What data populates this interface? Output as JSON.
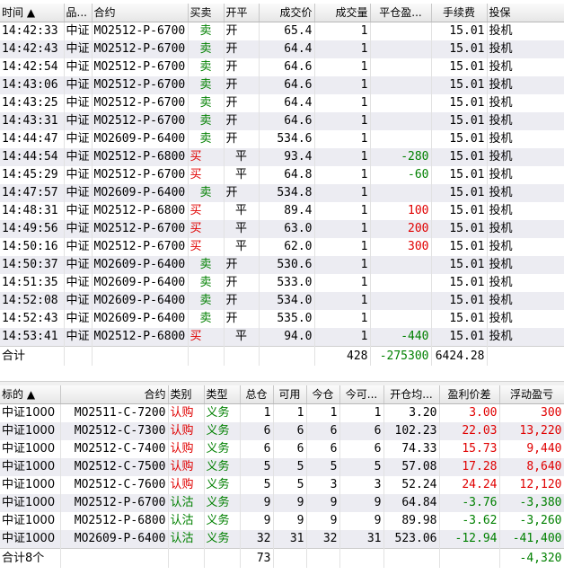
{
  "trades": {
    "headers": [
      "时间 ▲",
      "品...",
      "合约",
      "买卖",
      "开平",
      "成交价",
      "成交量",
      "平仓盈...",
      "手续费",
      "投保"
    ],
    "rows": [
      {
        "time": "14:42:33",
        "variety": "中证",
        "contract": "MO2512-P-6700",
        "side": "卖",
        "oc": "开",
        "price": "65.4",
        "qty": "1",
        "pnl": "",
        "fee": "15.01",
        "hedge": "投机"
      },
      {
        "time": "14:42:43",
        "variety": "中证",
        "contract": "MO2512-P-6700",
        "side": "卖",
        "oc": "开",
        "price": "64.4",
        "qty": "1",
        "pnl": "",
        "fee": "15.01",
        "hedge": "投机"
      },
      {
        "time": "14:42:54",
        "variety": "中证",
        "contract": "MO2512-P-6700",
        "side": "卖",
        "oc": "开",
        "price": "64.6",
        "qty": "1",
        "pnl": "",
        "fee": "15.01",
        "hedge": "投机"
      },
      {
        "time": "14:43:06",
        "variety": "中证",
        "contract": "MO2512-P-6700",
        "side": "卖",
        "oc": "开",
        "price": "64.6",
        "qty": "1",
        "pnl": "",
        "fee": "15.01",
        "hedge": "投机"
      },
      {
        "time": "14:43:25",
        "variety": "中证",
        "contract": "MO2512-P-6700",
        "side": "卖",
        "oc": "开",
        "price": "64.4",
        "qty": "1",
        "pnl": "",
        "fee": "15.01",
        "hedge": "投机"
      },
      {
        "time": "14:43:31",
        "variety": "中证",
        "contract": "MO2512-P-6700",
        "side": "卖",
        "oc": "开",
        "price": "64.6",
        "qty": "1",
        "pnl": "",
        "fee": "15.01",
        "hedge": "投机"
      },
      {
        "time": "14:44:47",
        "variety": "中证",
        "contract": "MO2609-P-6400",
        "side": "卖",
        "oc": "开",
        "price": "534.6",
        "qty": "1",
        "pnl": "",
        "fee": "15.01",
        "hedge": "投机"
      },
      {
        "time": "14:44:54",
        "variety": "中证",
        "contract": "MO2512-P-6800",
        "side": "买",
        "oc": "平",
        "price": "93.4",
        "qty": "1",
        "pnl": "-280",
        "fee": "15.01",
        "hedge": "投机"
      },
      {
        "time": "14:45:29",
        "variety": "中证",
        "contract": "MO2512-P-6700",
        "side": "买",
        "oc": "平",
        "price": "64.8",
        "qty": "1",
        "pnl": "-60",
        "fee": "15.01",
        "hedge": "投机"
      },
      {
        "time": "14:47:57",
        "variety": "中证",
        "contract": "MO2609-P-6400",
        "side": "卖",
        "oc": "开",
        "price": "534.8",
        "qty": "1",
        "pnl": "",
        "fee": "15.01",
        "hedge": "投机"
      },
      {
        "time": "14:48:31",
        "variety": "中证",
        "contract": "MO2512-P-6800",
        "side": "买",
        "oc": "平",
        "price": "89.4",
        "qty": "1",
        "pnl": "100",
        "fee": "15.01",
        "hedge": "投机"
      },
      {
        "time": "14:49:56",
        "variety": "中证",
        "contract": "MO2512-P-6700",
        "side": "买",
        "oc": "平",
        "price": "63.0",
        "qty": "1",
        "pnl": "200",
        "fee": "15.01",
        "hedge": "投机"
      },
      {
        "time": "14:50:16",
        "variety": "中证",
        "contract": "MO2512-P-6700",
        "side": "买",
        "oc": "平",
        "price": "62.0",
        "qty": "1",
        "pnl": "300",
        "fee": "15.01",
        "hedge": "投机"
      },
      {
        "time": "14:50:37",
        "variety": "中证",
        "contract": "MO2609-P-6400",
        "side": "卖",
        "oc": "开",
        "price": "530.6",
        "qty": "1",
        "pnl": "",
        "fee": "15.01",
        "hedge": "投机"
      },
      {
        "time": "14:51:35",
        "variety": "中证",
        "contract": "MO2609-P-6400",
        "side": "卖",
        "oc": "开",
        "price": "533.0",
        "qty": "1",
        "pnl": "",
        "fee": "15.01",
        "hedge": "投机"
      },
      {
        "time": "14:52:08",
        "variety": "中证",
        "contract": "MO2609-P-6400",
        "side": "卖",
        "oc": "开",
        "price": "534.0",
        "qty": "1",
        "pnl": "",
        "fee": "15.01",
        "hedge": "投机"
      },
      {
        "time": "14:52:43",
        "variety": "中证",
        "contract": "MO2609-P-6400",
        "side": "卖",
        "oc": "开",
        "price": "535.0",
        "qty": "1",
        "pnl": "",
        "fee": "15.01",
        "hedge": "投机"
      },
      {
        "time": "14:53:41",
        "variety": "中证",
        "contract": "MO2512-P-6800",
        "side": "买",
        "oc": "平",
        "price": "94.0",
        "qty": "1",
        "pnl": "-440",
        "fee": "15.01",
        "hedge": "投机"
      }
    ],
    "total": {
      "label": "合计",
      "qty": "428",
      "pnl": "-275300",
      "fee": "6424.28"
    }
  },
  "positions": {
    "headers": [
      "标的 ▲",
      "合约",
      "类别",
      "类型",
      "总仓",
      "可用",
      "今仓",
      "今可...",
      "开仓均...",
      "盈利价差",
      "浮动盈亏"
    ],
    "rows": [
      {
        "underlying": "中证1000",
        "contract": "MO2511-C-7200",
        "cat": "认购",
        "kind": "义务",
        "total": "1",
        "avail": "1",
        "today": "1",
        "today_avail": "1",
        "avg": "3.20",
        "spread": "3.00",
        "float": "300"
      },
      {
        "underlying": "中证1000",
        "contract": "MO2512-C-7300",
        "cat": "认购",
        "kind": "义务",
        "total": "6",
        "avail": "6",
        "today": "6",
        "today_avail": "6",
        "avg": "102.23",
        "spread": "22.03",
        "float": "13,220"
      },
      {
        "underlying": "中证1000",
        "contract": "MO2512-C-7400",
        "cat": "认购",
        "kind": "义务",
        "total": "6",
        "avail": "6",
        "today": "6",
        "today_avail": "6",
        "avg": "74.33",
        "spread": "15.73",
        "float": "9,440"
      },
      {
        "underlying": "中证1000",
        "contract": "MO2512-C-7500",
        "cat": "认购",
        "kind": "义务",
        "total": "5",
        "avail": "5",
        "today": "5",
        "today_avail": "5",
        "avg": "57.08",
        "spread": "17.28",
        "float": "8,640"
      },
      {
        "underlying": "中证1000",
        "contract": "MO2512-C-7600",
        "cat": "认购",
        "kind": "义务",
        "total": "5",
        "avail": "5",
        "today": "3",
        "today_avail": "3",
        "avg": "52.24",
        "spread": "24.24",
        "float": "12,120"
      },
      {
        "underlying": "中证1000",
        "contract": "MO2512-P-6700",
        "cat": "认沽",
        "kind": "义务",
        "total": "9",
        "avail": "9",
        "today": "9",
        "today_avail": "9",
        "avg": "64.84",
        "spread": "-3.76",
        "float": "-3,380"
      },
      {
        "underlying": "中证1000",
        "contract": "MO2512-P-6800",
        "cat": "认沽",
        "kind": "义务",
        "total": "9",
        "avail": "9",
        "today": "9",
        "today_avail": "9",
        "avg": "89.98",
        "spread": "-3.62",
        "float": "-3,260"
      },
      {
        "underlying": "中证1000",
        "contract": "MO2609-P-6400",
        "cat": "认沽",
        "kind": "义务",
        "total": "32",
        "avail": "31",
        "today": "32",
        "today_avail": "31",
        "avg": "523.06",
        "spread": "-12.94",
        "float": "-41,400"
      }
    ],
    "total": {
      "label": "合计8个",
      "total": "73",
      "float": "-4,320"
    }
  }
}
